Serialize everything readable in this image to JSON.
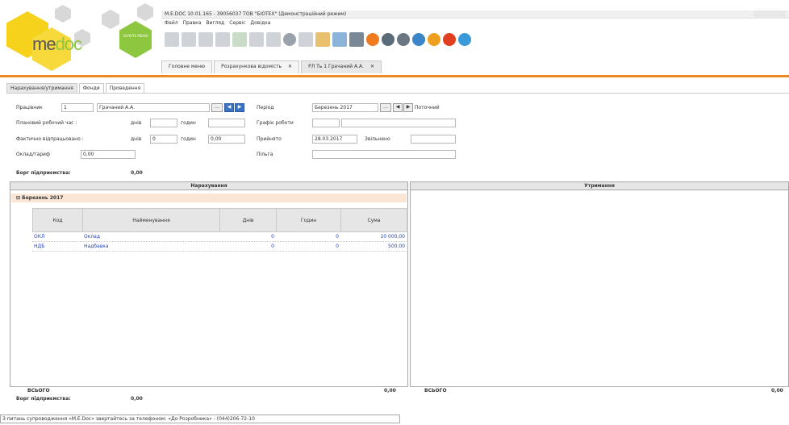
{
  "app": {
    "title": "M.E.DOC 10.01.165 - 39056037 ТОВ \"БІОТЕХ\" (Демонстраційний режим)",
    "logo_text_a": "me",
    "logo_text_b": "doc",
    "green_badge": "ЗОЛОТЕ МЕНЮ"
  },
  "menu": [
    "Файл",
    "Правка",
    "Вигляд",
    "Сервіс",
    "Довідка"
  ],
  "toolbar": {
    "icons": [
      "new-doc-icon",
      "open-doc-icon",
      "copy-doc-icon",
      "report-icon",
      "add-icon",
      "search-icon",
      "filter-icon",
      "archive-icon",
      "blank-doc-icon",
      "chart-icon",
      "sign-icon",
      "print-icon",
      "package-icon",
      "send-icon",
      "receive-icon",
      "refresh-icon",
      "help-icon",
      "chat-icon",
      "network-icon"
    ],
    "colors": [
      "#f07b1f",
      "#5a6b7a",
      "#3a86c8",
      "#f0a020",
      "#e04020",
      "#3a9ad9"
    ]
  },
  "tabs": [
    {
      "label": "Головне меню",
      "closable": false
    },
    {
      "label": "Розрахункова відомість",
      "closable": true
    },
    {
      "label": "РЛ Ть 1 Грачаний А.А.",
      "closable": true
    }
  ],
  "sub_tabs": [
    "Нарахування/утримання",
    "Фонди",
    "Проведення"
  ],
  "form": {
    "employee_label": "Працівник",
    "employee_num": "1",
    "employee_name": "Грачаний А.А.",
    "period_label": "Період",
    "period_value": "Березень 2017",
    "period_current": "Поточний",
    "planned_label": "Плановий робочий час :",
    "days_label": "днів",
    "hours_label": "годин",
    "schedule_label": "Графік роботи",
    "actual_label": "Фактично відпрацьовано :",
    "actual_days": "0",
    "actual_hours": "0,00",
    "hired_label": "Прийнято",
    "hired_value": "28.03.2017",
    "fired_label": "Звільнено",
    "salary_label": "Оклад/тариф",
    "salary_value": "0,00",
    "benefit_label": "Пільга",
    "debt_label": "Борг підприємства:",
    "debt_value": "0,00"
  },
  "accruals": {
    "title": "Нарахування",
    "month": "Березень 2017",
    "columns": [
      "Код",
      "Найменування",
      "Днів",
      "Годин",
      "Сума"
    ],
    "rows": [
      {
        "code": "ОКЛ",
        "name": "Оклад",
        "days": "0",
        "hours": "0",
        "sum": "10 000,00"
      },
      {
        "code": "НДБ",
        "name": "Надбавка",
        "days": "0",
        "hours": "0",
        "sum": "500,00"
      }
    ],
    "total_label": "ВСЬОГО",
    "total_value": "0,00",
    "debt_label": "Борг підприємства:",
    "debt_value": "0,00"
  },
  "deductions": {
    "title": "Утримання",
    "total_label": "ВСЬОГО",
    "total_value": "0,00"
  },
  "status": "З питань супроводження «M.E.Doc» звертайтесь за телефоном: «До Розробника» - (044)206-72-10"
}
